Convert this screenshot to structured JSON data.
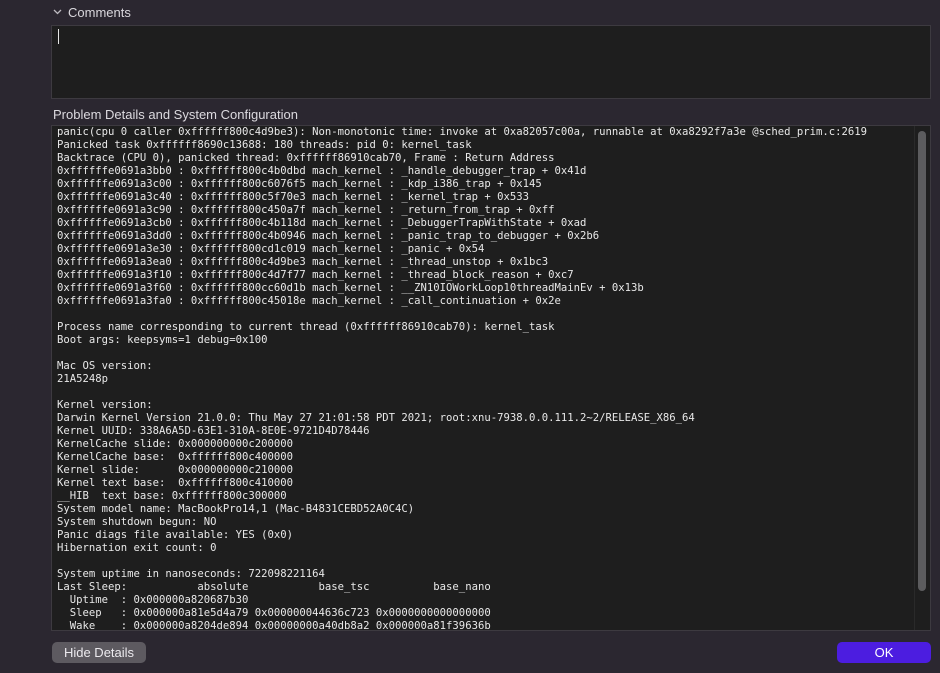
{
  "comments": {
    "label": "Comments",
    "value": ""
  },
  "details": {
    "title": "Problem Details and System Configuration",
    "text": "panic(cpu 0 caller 0xffffff800c4d9be3): Non-monotonic time: invoke at 0xa82057c00a, runnable at 0xa8292f7a3e @sched_prim.c:2619\nPanicked task 0xffffff8690c13688: 180 threads: pid 0: kernel_task\nBacktrace (CPU 0), panicked thread: 0xffffff86910cab70, Frame : Return Address\n0xffffffe0691a3bb0 : 0xffffff800c4b0dbd mach_kernel : _handle_debugger_trap + 0x41d\n0xffffffe0691a3c00 : 0xffffff800c6076f5 mach_kernel : _kdp_i386_trap + 0x145\n0xffffffe0691a3c40 : 0xffffff800c5f70e3 mach_kernel : _kernel_trap + 0x533\n0xffffffe0691a3c90 : 0xffffff800c450a7f mach_kernel : _return_from_trap + 0xff\n0xffffffe0691a3cb0 : 0xffffff800c4b118d mach_kernel : _DebuggerTrapWithState + 0xad\n0xffffffe0691a3dd0 : 0xffffff800c4b0946 mach_kernel : _panic_trap_to_debugger + 0x2b6\n0xffffffe0691a3e30 : 0xffffff800cd1c019 mach_kernel : _panic + 0x54\n0xffffffe0691a3ea0 : 0xffffff800c4d9be3 mach_kernel : _thread_unstop + 0x1bc3\n0xffffffe0691a3f10 : 0xffffff800c4d7f77 mach_kernel : _thread_block_reason + 0xc7\n0xffffffe0691a3f60 : 0xffffff800cc60d1b mach_kernel : __ZN10IOWorkLoop10threadMainEv + 0x13b\n0xffffffe0691a3fa0 : 0xffffff800c45018e mach_kernel : _call_continuation + 0x2e\n\nProcess name corresponding to current thread (0xffffff86910cab70): kernel_task\nBoot args: keepsyms=1 debug=0x100\n\nMac OS version:\n21A5248p\n\nKernel version:\nDarwin Kernel Version 21.0.0: Thu May 27 21:01:58 PDT 2021; root:xnu-7938.0.0.111.2~2/RELEASE_X86_64\nKernel UUID: 338A6A5D-63E1-310A-8E0E-9721D4D78446\nKernelCache slide: 0x000000000c200000\nKernelCache base:  0xffffff800c400000\nKernel slide:      0x000000000c210000\nKernel text base:  0xffffff800c410000\n__HIB  text base: 0xffffff800c300000\nSystem model name: MacBookPro14,1 (Mac-B4831CEBD52A0C4C)\nSystem shutdown begun: NO\nPanic diags file available: YES (0x0)\nHibernation exit count: 0\n\nSystem uptime in nanoseconds: 722098221164\nLast Sleep:           absolute           base_tsc          base_nano\n  Uptime  : 0x000000a820687b30\n  Sleep   : 0x000000a81e5d4a79 0x000000044636c723 0x0000000000000000\n  Wake    : 0x000000a8204de894 0x00000000a40db8a2 0x000000a81f39636b"
  },
  "buttons": {
    "hide_details": "Hide Details",
    "ok": "OK"
  },
  "colors": {
    "background": "#2b2730",
    "panel": "#1e1e1e",
    "accent": "#4c1de0",
    "secondary_button": "#5d5a60"
  },
  "icons": {
    "comments_toggle": "chevron-down-icon"
  }
}
